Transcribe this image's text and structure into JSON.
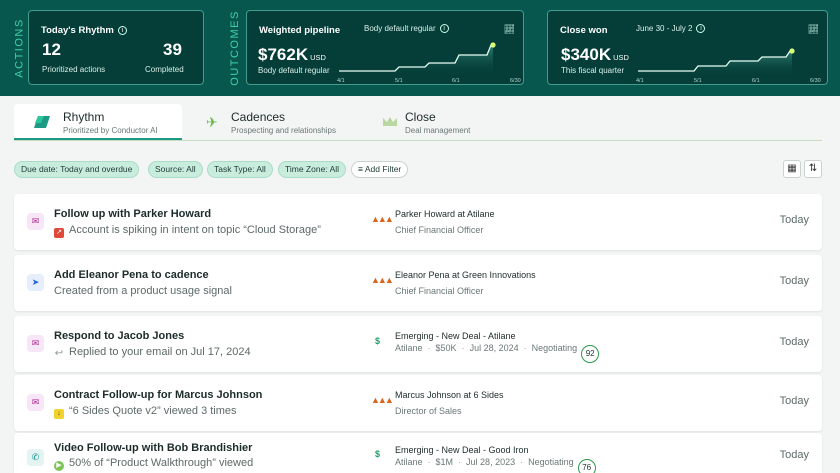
{
  "labels": {
    "actions": "ACTIONS",
    "outcomes": "OUTCOMES"
  },
  "rhythm": {
    "title": "Today's Rhythm",
    "prioritized_value": "12",
    "prioritized_label": "Prioritized actions",
    "completed_value": "39",
    "completed_label": "Completed"
  },
  "pipeline": {
    "title": "Weighted pipeline",
    "filter": "Body default regular",
    "value": "$762K",
    "currency": "USD",
    "subtitle": "Body default regular",
    "ticks": [
      "4/1",
      "5/1",
      "6/1",
      "6/30"
    ]
  },
  "close_won": {
    "title": "Close won",
    "range": "June 30 - July 2",
    "value": "$340K",
    "currency": "USD",
    "subtitle": "This fiscal quarter",
    "ticks": [
      "4/1",
      "5/1",
      "6/1",
      "6/30"
    ]
  },
  "tabs": [
    {
      "name": "Rhythm",
      "sub": "Prioritized by Conductor AI"
    },
    {
      "name": "Cadences",
      "sub": "Prospecting and relationships"
    },
    {
      "name": "Close",
      "sub": "Deal management"
    }
  ],
  "filters": [
    "Due date: Today and overdue",
    "Source: All",
    "Task Type: All",
    "Time Zone: All"
  ],
  "add_filter": "Add Filter",
  "tasks": [
    {
      "title": "Follow up with Parker Howard",
      "sub": "Account is spiking in intent on topic “Cloud Storage”",
      "contact": "Parker Howard  at  Atilane",
      "role": "Chief Financial Officer",
      "when": "Today"
    },
    {
      "title": "Add Eleanor Pena to cadence",
      "sub": "Created from a product usage signal",
      "contact": "Eleanor Pena  at  Green Innovations",
      "role": "Chief Financial Officer",
      "when": "Today"
    },
    {
      "title": "Respond to Jacob Jones",
      "sub": "Replied to your email on Jul 17, 2024",
      "deal": "Emerging - New Deal - Atilane",
      "company": "Atilane",
      "amount": "$50K",
      "date": "Jul 28, 2024",
      "stage": "Negotiating",
      "score": "92",
      "when": "Today"
    },
    {
      "title": "Contract Follow-up for Marcus Johnson",
      "sub": "“6 Sides Quote v2” viewed 3 times",
      "contact": "Marcus Johnson  at  6 Sides",
      "role": "Director of Sales",
      "when": "Today"
    },
    {
      "title": "Video Follow-up with Bob Brandishier",
      "sub": "50% of “Product Walkthrough” viewed",
      "deal": "Emerging - New Deal - Good Iron",
      "company": "Atilane",
      "amount": "$1M",
      "date": "Jul 28, 2023",
      "stage": "Negotiating",
      "score": "76",
      "when": "Today"
    }
  ],
  "colors": {
    "header_bg": "#08574e",
    "card_bg": "#053e38",
    "accent": "#1d9a84",
    "chip_bg": "#c9eddd",
    "line_highlight": "#d9ff7a"
  }
}
